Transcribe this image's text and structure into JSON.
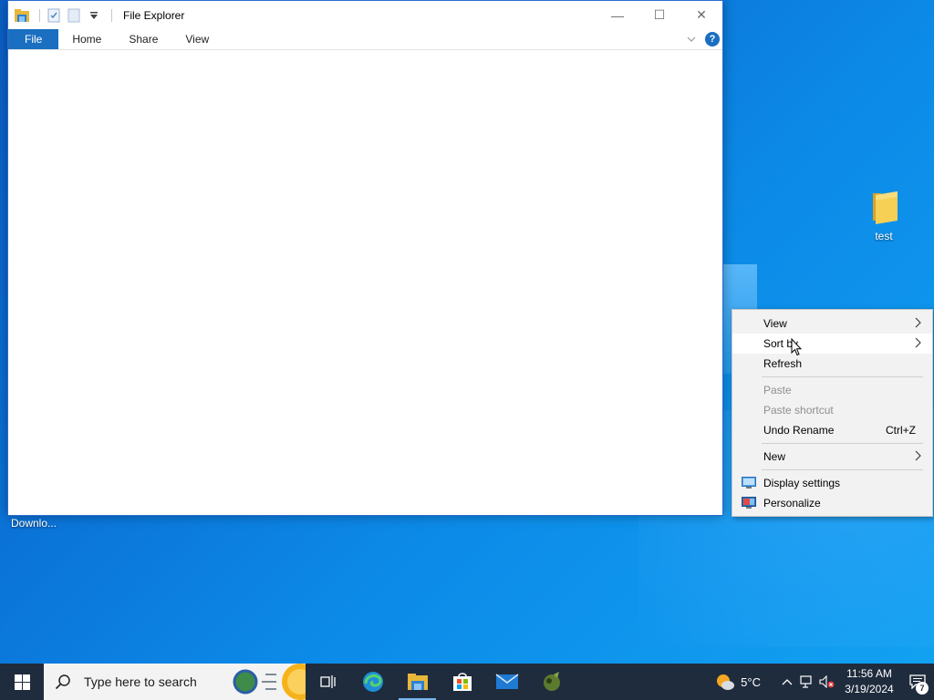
{
  "window": {
    "title": "File Explorer",
    "tabs": [
      "File",
      "Home",
      "Share",
      "View"
    ],
    "controls": {
      "minimize": "—",
      "maximize": "☐",
      "close": "✕"
    }
  },
  "desktop": {
    "icons": [
      {
        "label": "test"
      },
      {
        "label": "Downlo..."
      }
    ]
  },
  "context_menu": {
    "items": [
      {
        "label": "View",
        "has_submenu": true
      },
      {
        "label": "Sort by",
        "has_submenu": true,
        "hover": true
      },
      {
        "label": "Refresh"
      },
      {
        "label": "Paste",
        "disabled": true
      },
      {
        "label": "Paste shortcut",
        "disabled": true
      },
      {
        "label": "Undo Rename",
        "shortcut": "Ctrl+Z"
      },
      {
        "label": "New",
        "has_submenu": true
      },
      {
        "label": "Display settings",
        "icon": "display-icon"
      },
      {
        "label": "Personalize",
        "icon": "personalize-icon"
      }
    ]
  },
  "taskbar": {
    "search_placeholder": "Type here to search",
    "weather": {
      "temp": "5°C"
    },
    "clock": {
      "time": "11:56 AM",
      "date": "3/19/2024"
    },
    "notifications_count": "7",
    "colors": {
      "taskbar_bg": "#1f2c3d",
      "accent": "#1a6fc1"
    }
  }
}
